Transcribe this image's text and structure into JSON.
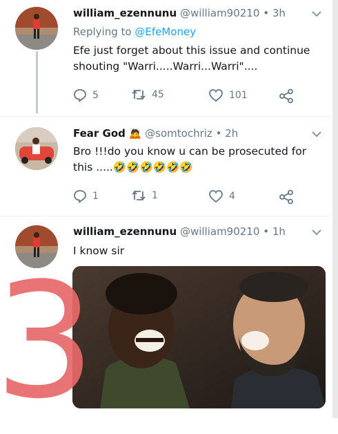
{
  "tweets": [
    {
      "name": "william_ezennunu",
      "handle": "@william90210",
      "time": "3h",
      "reply_label": "Replying to",
      "reply_to": "@EfeMoney",
      "text_line1": "Efe just forget about this issue and continue",
      "text_line2": "shouting \"Warri.....Warri...Warri\"....",
      "replies": "5",
      "retweets": "45",
      "likes": "101"
    },
    {
      "name": "Fear God",
      "emoji": "🙇",
      "handle": "@somtochriz",
      "time": "2h",
      "text_line1": "Bro !!!do you know u can be prosecuted for",
      "text_line2": "this .....🤣🤣🤣🤣🤣🤣",
      "replies": "1",
      "retweets": "1",
      "likes": "4"
    },
    {
      "name": "william_ezennunu",
      "handle": "@william90210",
      "time": "1h",
      "text_line1": "I know sir"
    }
  ],
  "separator": "•",
  "overlay_number": "3",
  "icons": {
    "reply": "reply-icon",
    "retweet": "retweet-icon",
    "like": "heart-icon",
    "share": "share-icon",
    "menu": "chevron-down-icon"
  },
  "colors": {
    "link_blue": "#1da1f2",
    "secondary_gray": "#657786",
    "overlay_red": "#e8696a"
  }
}
